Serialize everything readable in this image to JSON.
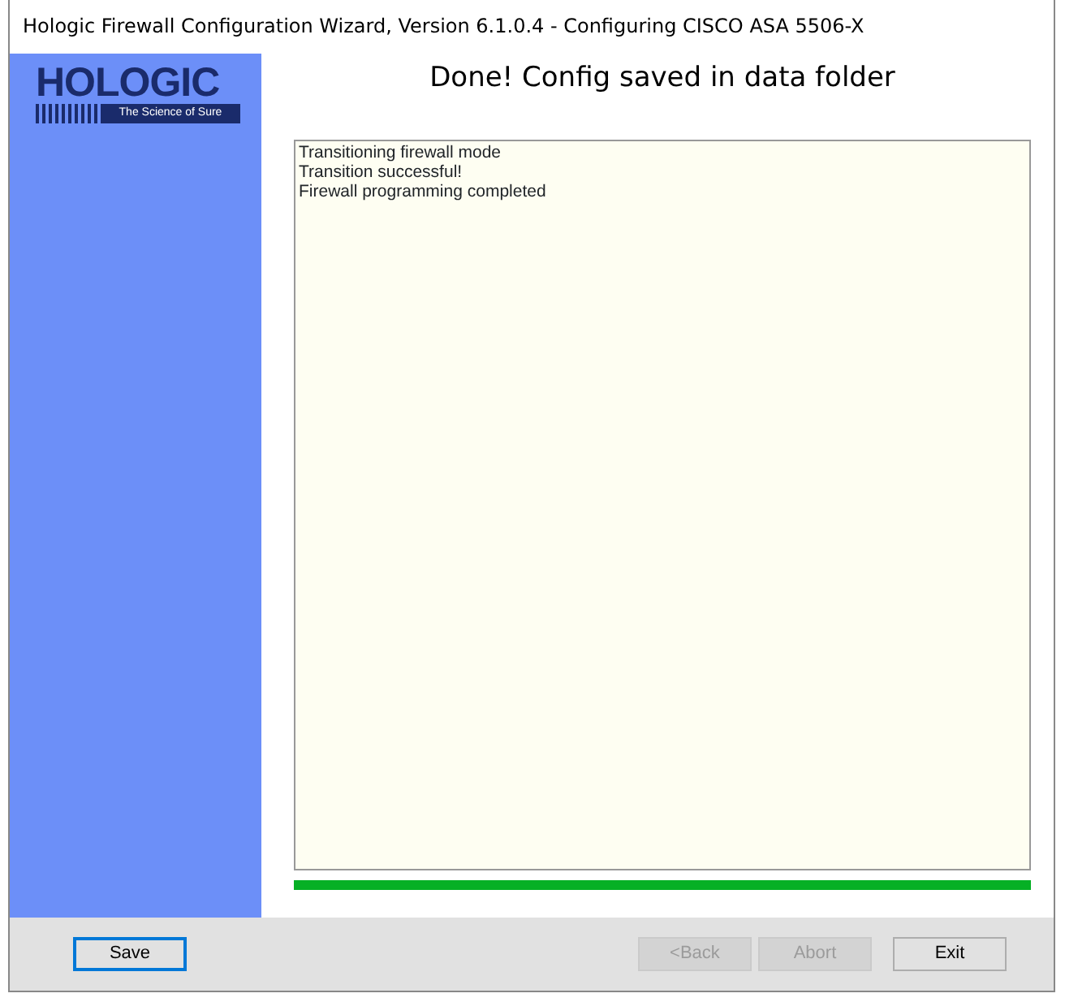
{
  "window": {
    "title": "Hologic Firewall Configuration Wizard, Version 6.1.0.4 - Configuring CISCO ASA 5506-X"
  },
  "logo": {
    "name": "HOLOGIC",
    "tagline": "The Science of Sure"
  },
  "heading": "Done! Config saved in data folder",
  "log": [
    "Transitioning firewall mode",
    "Transition successful!",
    "Firewall programming completed"
  ],
  "progress": {
    "level": 1
  },
  "buttons": [
    {
      "label": "Save",
      "disabled": false,
      "focused": true
    },
    {
      "label": "<Back",
      "disabled": true,
      "focused": false
    },
    {
      "label": "Abort",
      "disabled": true,
      "focused": false
    },
    {
      "label": "Exit",
      "disabled": false,
      "focused": false
    }
  ]
}
